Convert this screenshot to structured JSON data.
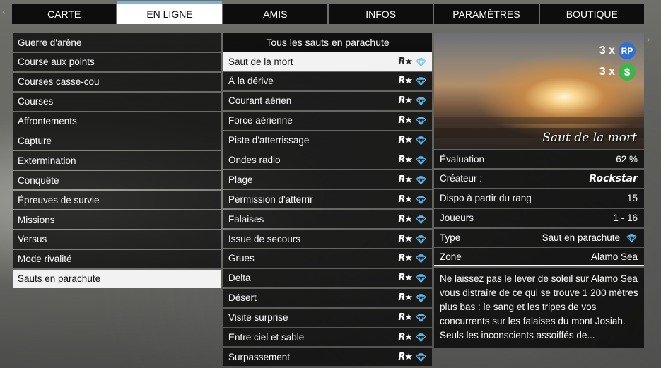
{
  "tabs": [
    "CARTE",
    "EN LIGNE",
    "AMIS",
    "INFOS",
    "PARAMÈTRES",
    "BOUTIQUE"
  ],
  "active_tab_index": 1,
  "nav": {
    "left_arrow": "‹",
    "right_arrow": "›"
  },
  "left_menu": [
    "Guerre d'arène",
    "Course aux points",
    "Courses casse-cou",
    "Courses",
    "Affrontements",
    "Capture",
    "Extermination",
    "Conquête",
    "Épreuves de survie",
    "Missions",
    "Versus",
    "Mode rivalité",
    "Sauts en parachute"
  ],
  "left_selected_index": 12,
  "mid_header": "Tous les sauts en parachute",
  "jumps": [
    "Saut de la mort",
    "À la dérive",
    "Courant aérien",
    "Force aérienne",
    "Piste d'atterrissage",
    "Ondes radio",
    "Plage",
    "Permission d'atterrir",
    "Falaises",
    "Issue de secours",
    "Grues",
    "Delta",
    "Désert",
    "Visite surprise",
    "Entre ciel et sable",
    "Surpassement"
  ],
  "jump_selected_index": 0,
  "row_badge": "R★",
  "row_icon": "parachute-icon",
  "accent_color": "#6bb8e8",
  "preview": {
    "title": "Saut de la mort",
    "rp_multiplier": "3 x",
    "rp_label": "RP",
    "cash_multiplier": "3 x",
    "cash_label": "$"
  },
  "details": {
    "rating_label": "Évaluation",
    "rating_value": "62 %",
    "creator_label": "Créateur :",
    "creator_value": "Rockstar",
    "rank_label": "Dispo à partir du rang",
    "rank_value": "15",
    "players_label": "Joueurs",
    "players_value": "1 - 16",
    "type_label": "Type",
    "type_value": "Saut en parachute",
    "zone_label": "Zone",
    "zone_value": "Alamo Sea"
  },
  "description": "Ne laissez pas le lever de soleil sur Alamo Sea vous distraire de ce qui se trouve 1 200 mètres plus bas : le sang et les tripes de vos concurrents sur les falaises du mont Josiah. Seuls les inconscients assoiffés de..."
}
